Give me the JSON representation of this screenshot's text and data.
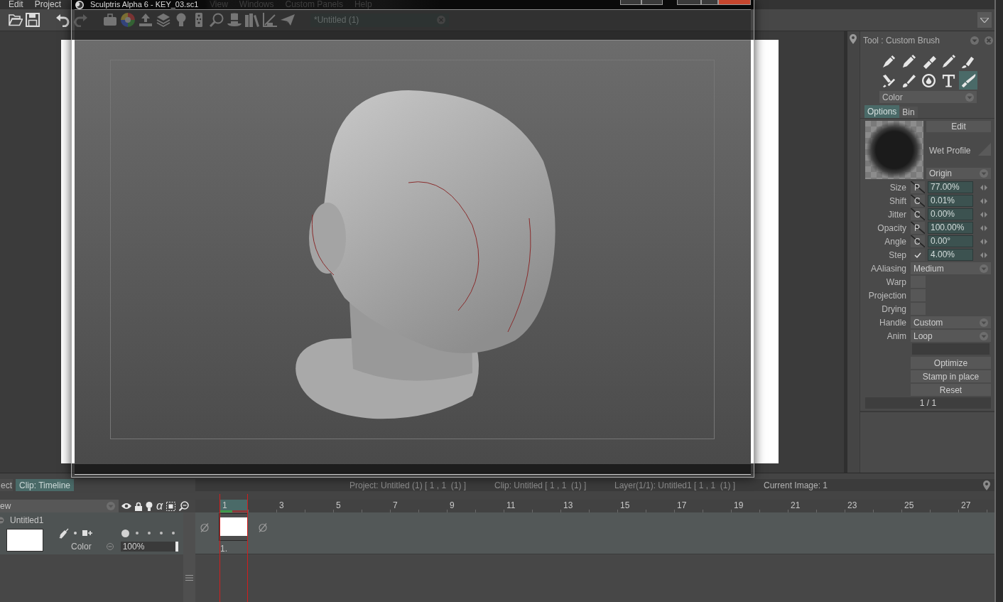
{
  "app_menu": [
    {
      "label": "Edit"
    },
    {
      "label": "Project"
    },
    {
      "label": "View"
    },
    {
      "label": "Windows"
    },
    {
      "label": "Custom Panels"
    },
    {
      "label": "Help"
    }
  ],
  "document_tab": {
    "label": "*Untitled (1)"
  },
  "sculptris_window": {
    "title": "Sculptris Alpha 6 - KEY_03.sc1"
  },
  "tool_panel": {
    "title": "Tool : Custom Brush",
    "tools": [
      {
        "selected": false
      },
      {
        "selected": false
      },
      {
        "selected": false
      },
      {
        "selected": false
      },
      {
        "selected": false
      },
      {
        "selected": false
      },
      {
        "selected": false
      },
      {
        "selected": false
      },
      {
        "selected": false
      },
      {
        "selected": true
      }
    ],
    "mode": "Color",
    "tabs": [
      {
        "label": "Options",
        "selected": true
      },
      {
        "label": "Bin",
        "selected": false
      }
    ],
    "edit_button": "Edit",
    "profile_label": "Wet Profile",
    "origin": "Origin",
    "parameters": [
      {
        "kind": "mode",
        "label": "Size",
        "mode": "P",
        "value": "77.00%"
      },
      {
        "kind": "mode",
        "label": "Shift",
        "mode": "C",
        "value": "0.01%"
      },
      {
        "kind": "mode",
        "label": "Jitter",
        "mode": "C",
        "value": "0.00%"
      },
      {
        "kind": "mode",
        "label": "Opacity",
        "mode": "P",
        "value": "100.00%"
      },
      {
        "kind": "mode",
        "label": "Angle",
        "mode": "C",
        "value": "0.00°"
      },
      {
        "kind": "check",
        "label": "Step",
        "checked": true,
        "value": "4.00%"
      }
    ],
    "settings": [
      {
        "kind": "dropdown",
        "label": "AAliasing",
        "value": "Medium"
      },
      {
        "kind": "checkbox",
        "label": "Warp",
        "checked": false
      },
      {
        "kind": "checkbox",
        "label": "Projection",
        "checked": false
      },
      {
        "kind": "checkbox",
        "label": "Drying",
        "checked": false
      },
      {
        "kind": "dropdown",
        "label": "Handle",
        "value": "Custom"
      },
      {
        "kind": "dropdown",
        "label": "Anim",
        "value": "Loop"
      }
    ],
    "buttons": [
      {
        "label": "Optimize"
      },
      {
        "label": "Stamp in place"
      },
      {
        "label": "Reset"
      }
    ],
    "page": "1 / 1"
  },
  "timeline_panel": {
    "tabs": [
      {
        "label": "ect",
        "selected": false
      },
      {
        "label": "Clip: Timeline",
        "selected": true
      }
    ],
    "status": [
      "Project: Untitled (1) [ 1 , 1  (1) ]",
      "Clip: Untitled [ 1 , 1  (1) ]",
      "Layer(1/1): Untitled1 [ 1 , 1  (1) ]",
      "Current Image: 1"
    ],
    "layer_header": {
      "label": "ew",
      "alpha_toggle": "α"
    },
    "layers": [
      {
        "name": "Untitled1",
        "onion": [
          {
            "selected": true
          },
          {
            "selected": false
          },
          {
            "selected": false
          },
          {
            "selected": false
          },
          {
            "selected": false
          }
        ],
        "blend_mode": "Color",
        "opacity": "100%",
        "level": 1
      }
    ],
    "ruler": [
      {
        "label": "1",
        "selected": true
      },
      {
        "label": "3",
        "selected": false
      },
      {
        "label": "5",
        "selected": false
      },
      {
        "label": "7",
        "selected": false
      },
      {
        "label": "9",
        "selected": false
      },
      {
        "label": "11",
        "selected": false
      },
      {
        "label": "13",
        "selected": false
      },
      {
        "label": "15",
        "selected": false
      },
      {
        "label": "17",
        "selected": false
      },
      {
        "label": "19",
        "selected": false
      },
      {
        "label": "21",
        "selected": false
      },
      {
        "label": "23",
        "selected": false
      },
      {
        "label": "25",
        "selected": false
      },
      {
        "label": "27",
        "selected": false
      }
    ],
    "images": [
      {
        "label": "1."
      }
    ]
  }
}
